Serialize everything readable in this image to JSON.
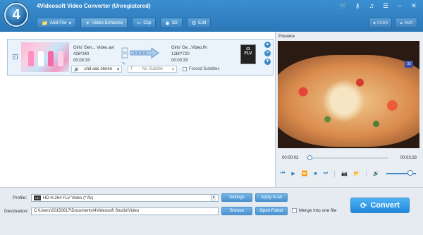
{
  "app": {
    "logo_text": "4",
    "title": "4Videosoft Video Converter (Unregistered)"
  },
  "window_icons": [
    "cart-icon",
    "key-icon",
    "audio-icon",
    "menu-icon",
    "minimize-icon",
    "close-icon"
  ],
  "toolbar": {
    "add_file": "Add File",
    "video_enhance": "Video Enhance",
    "clip": "Clip",
    "three_d": "3D",
    "edit": "Edit",
    "cuda": "CUDA",
    "amd": "AMD"
  },
  "file": {
    "src_name": "Girls' Gen... Video.avi",
    "src_res": "426*240",
    "src_dur": "00:03:33",
    "dst_name": "Girls' Ge...Video.flv",
    "dst_res": "1280*720",
    "dst_dur": "00:03:33",
    "format_label": "FLV",
    "audio": "und aac stereo",
    "subtitle": "No Subtitle",
    "forced_subtitles": "Forced Subtitles"
  },
  "preview": {
    "label": "Preview",
    "time_current": "00:00:03",
    "time_total": "00:03:33",
    "progress_fraction": 0.02,
    "volume_fraction": 0.8,
    "badge": "32"
  },
  "bottom": {
    "profile_label": "Profile:",
    "profile_value": "HD H.264 FLV Video (*.flv)",
    "settings": "Settings",
    "apply_to_all": "Apply to All",
    "destination_label": "Destination:",
    "destination_value": "C:\\Users\\20150617\\Documents\\4Videosoft Studio\\Video",
    "browse": "Browse",
    "open_folder": "Open Folder",
    "merge": "Merge into one file",
    "convert": "Convert"
  },
  "colors": {
    "accent": "#2b77b8",
    "convert": "#1f88db"
  }
}
